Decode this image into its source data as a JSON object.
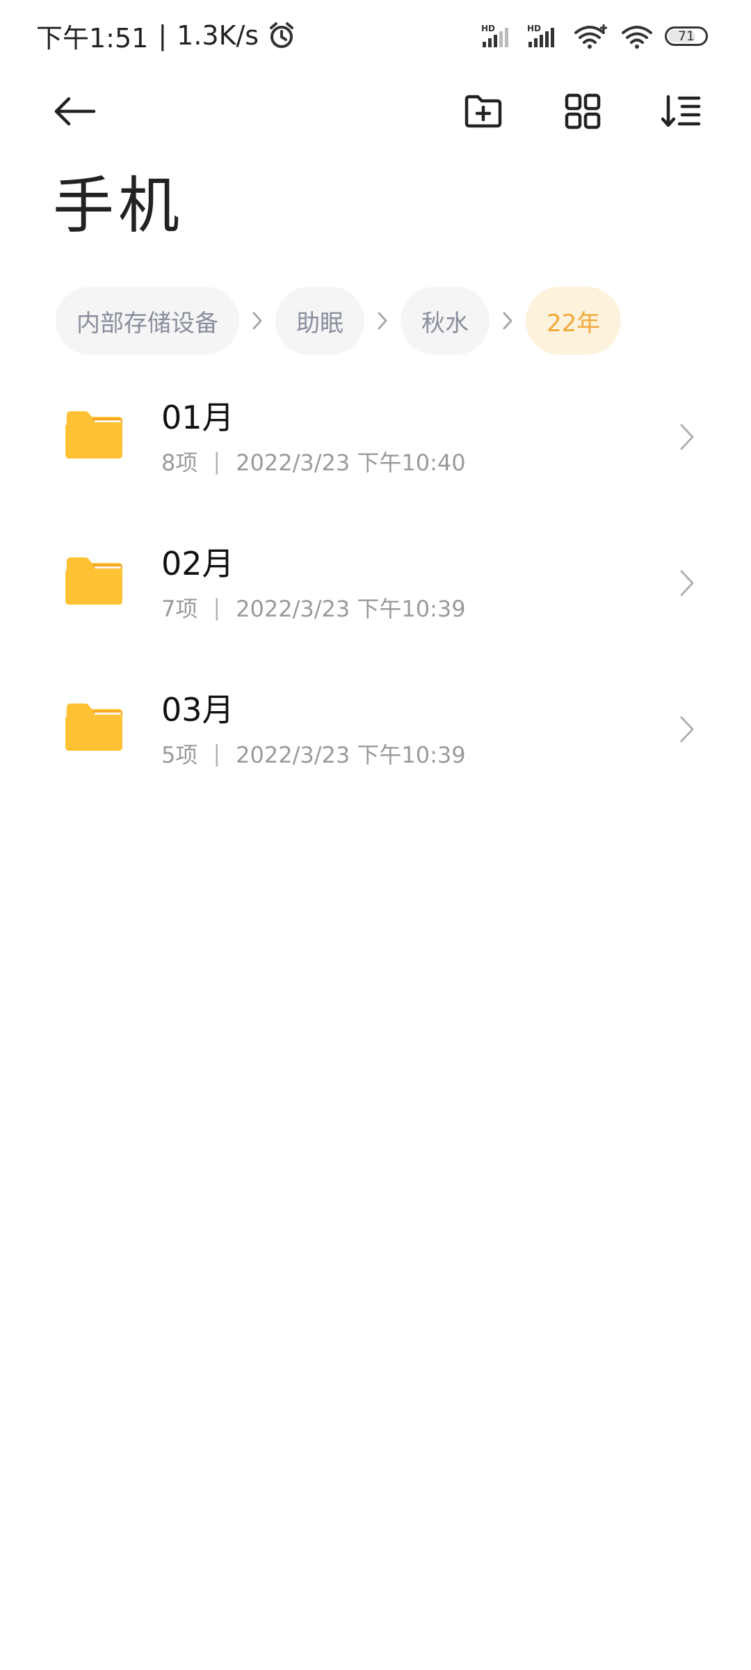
{
  "status_bar": {
    "time": "下午1:51",
    "separator": "|",
    "net_speed": "1.3K/s",
    "battery_level": "71",
    "icons": [
      "alarm-icon",
      "hd-signal-icon",
      "hd-signal-icon",
      "wifi-plus-icon",
      "wifi-icon",
      "battery-icon"
    ]
  },
  "toolbar": {
    "icons": [
      "back-arrow-icon",
      "new-folder-icon",
      "grid-view-icon",
      "sort-icon"
    ]
  },
  "page": {
    "title": "手机"
  },
  "breadcrumb": {
    "items": [
      {
        "label": "内部存储设备"
      },
      {
        "label": "助眠"
      },
      {
        "label": "秋水"
      },
      {
        "label": "22年"
      }
    ]
  },
  "files": [
    {
      "name": "01月",
      "count": "8项",
      "divider": "|",
      "modified": "2022/3/23 下午10:40"
    },
    {
      "name": "02月",
      "count": "7项",
      "divider": "|",
      "modified": "2022/3/23 下午10:39"
    },
    {
      "name": "03月",
      "count": "5项",
      "divider": "|",
      "modified": "2022/3/23 下午10:39"
    }
  ],
  "colors": {
    "accent": "#f2a93b",
    "active_crumb_bg": "#fdf2dc",
    "crumb_bg": "#f5f5f6",
    "folder_yellow": "#ffc235",
    "folder_tab_orange": "#f5a623"
  }
}
